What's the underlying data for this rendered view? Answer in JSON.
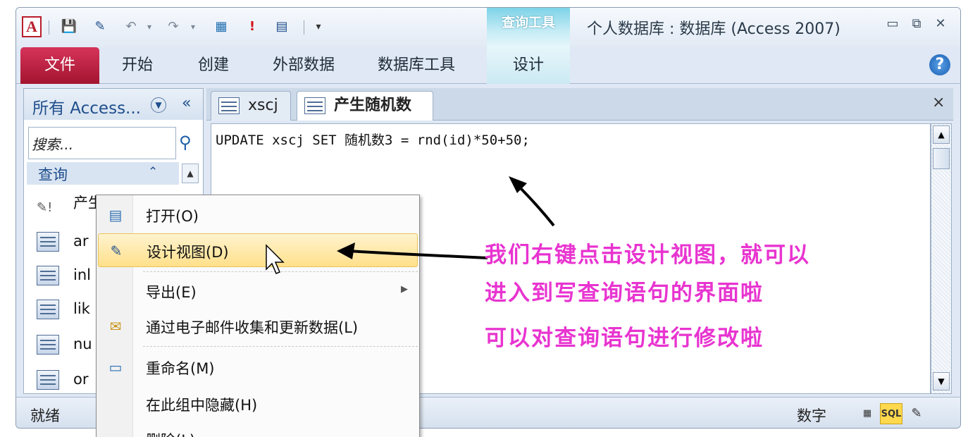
{
  "window": {
    "title": "个人数据库 : 数据库 (Access 2007)",
    "contextual_group": "查询工具",
    "controls": {
      "minimize": "▭",
      "restore": "⧉",
      "close": "✕"
    }
  },
  "qat": {
    "app_logo": "A",
    "icons": [
      "save-icon",
      "design-view-icon",
      "undo-icon",
      "redo-icon",
      "query-run-icon",
      "exclamation-icon",
      "table-icon",
      "customize-qat-icon"
    ]
  },
  "ribbon": {
    "file_tab": "文件",
    "tabs": [
      "开始",
      "创建",
      "外部数据",
      "数据库工具",
      "设计"
    ],
    "help": "?"
  },
  "nav": {
    "title": "所有 Access...",
    "collapse": "«",
    "search_placeholder": "搜索...",
    "group_label": "查询",
    "items": [
      "产生随机数",
      "ar",
      "inl",
      "lik",
      "nu",
      "or"
    ]
  },
  "doc": {
    "tabs": [
      "xscj",
      "产生随机数"
    ],
    "close": "×",
    "sql": "UPDATE xscj SET 随机数3 = rnd(id)*50+50;"
  },
  "context_menu": {
    "items": [
      {
        "label": "打开(O)"
      },
      {
        "label": "设计视图(D)"
      },
      {
        "label": "导出(E)"
      },
      {
        "label": "通过电子邮件收集和更新数据(L)"
      },
      {
        "label": "重命名(M)"
      },
      {
        "label": "在此组中隐藏(H)"
      },
      {
        "label": "删除(L)"
      }
    ]
  },
  "annotation": {
    "lines": [
      "我们右键点击设计视图，就可以",
      "进入到写查询语句的界面啦",
      "可以对查询语句进行修改啦"
    ],
    "color": "#e834d0"
  },
  "status": {
    "left": "就绪",
    "mode": "数字",
    "view_sql": "SQL"
  },
  "colors": {
    "file_tab": "#b81d2b",
    "contextual": "#7dd3e8",
    "highlight": "#ffe08a"
  }
}
